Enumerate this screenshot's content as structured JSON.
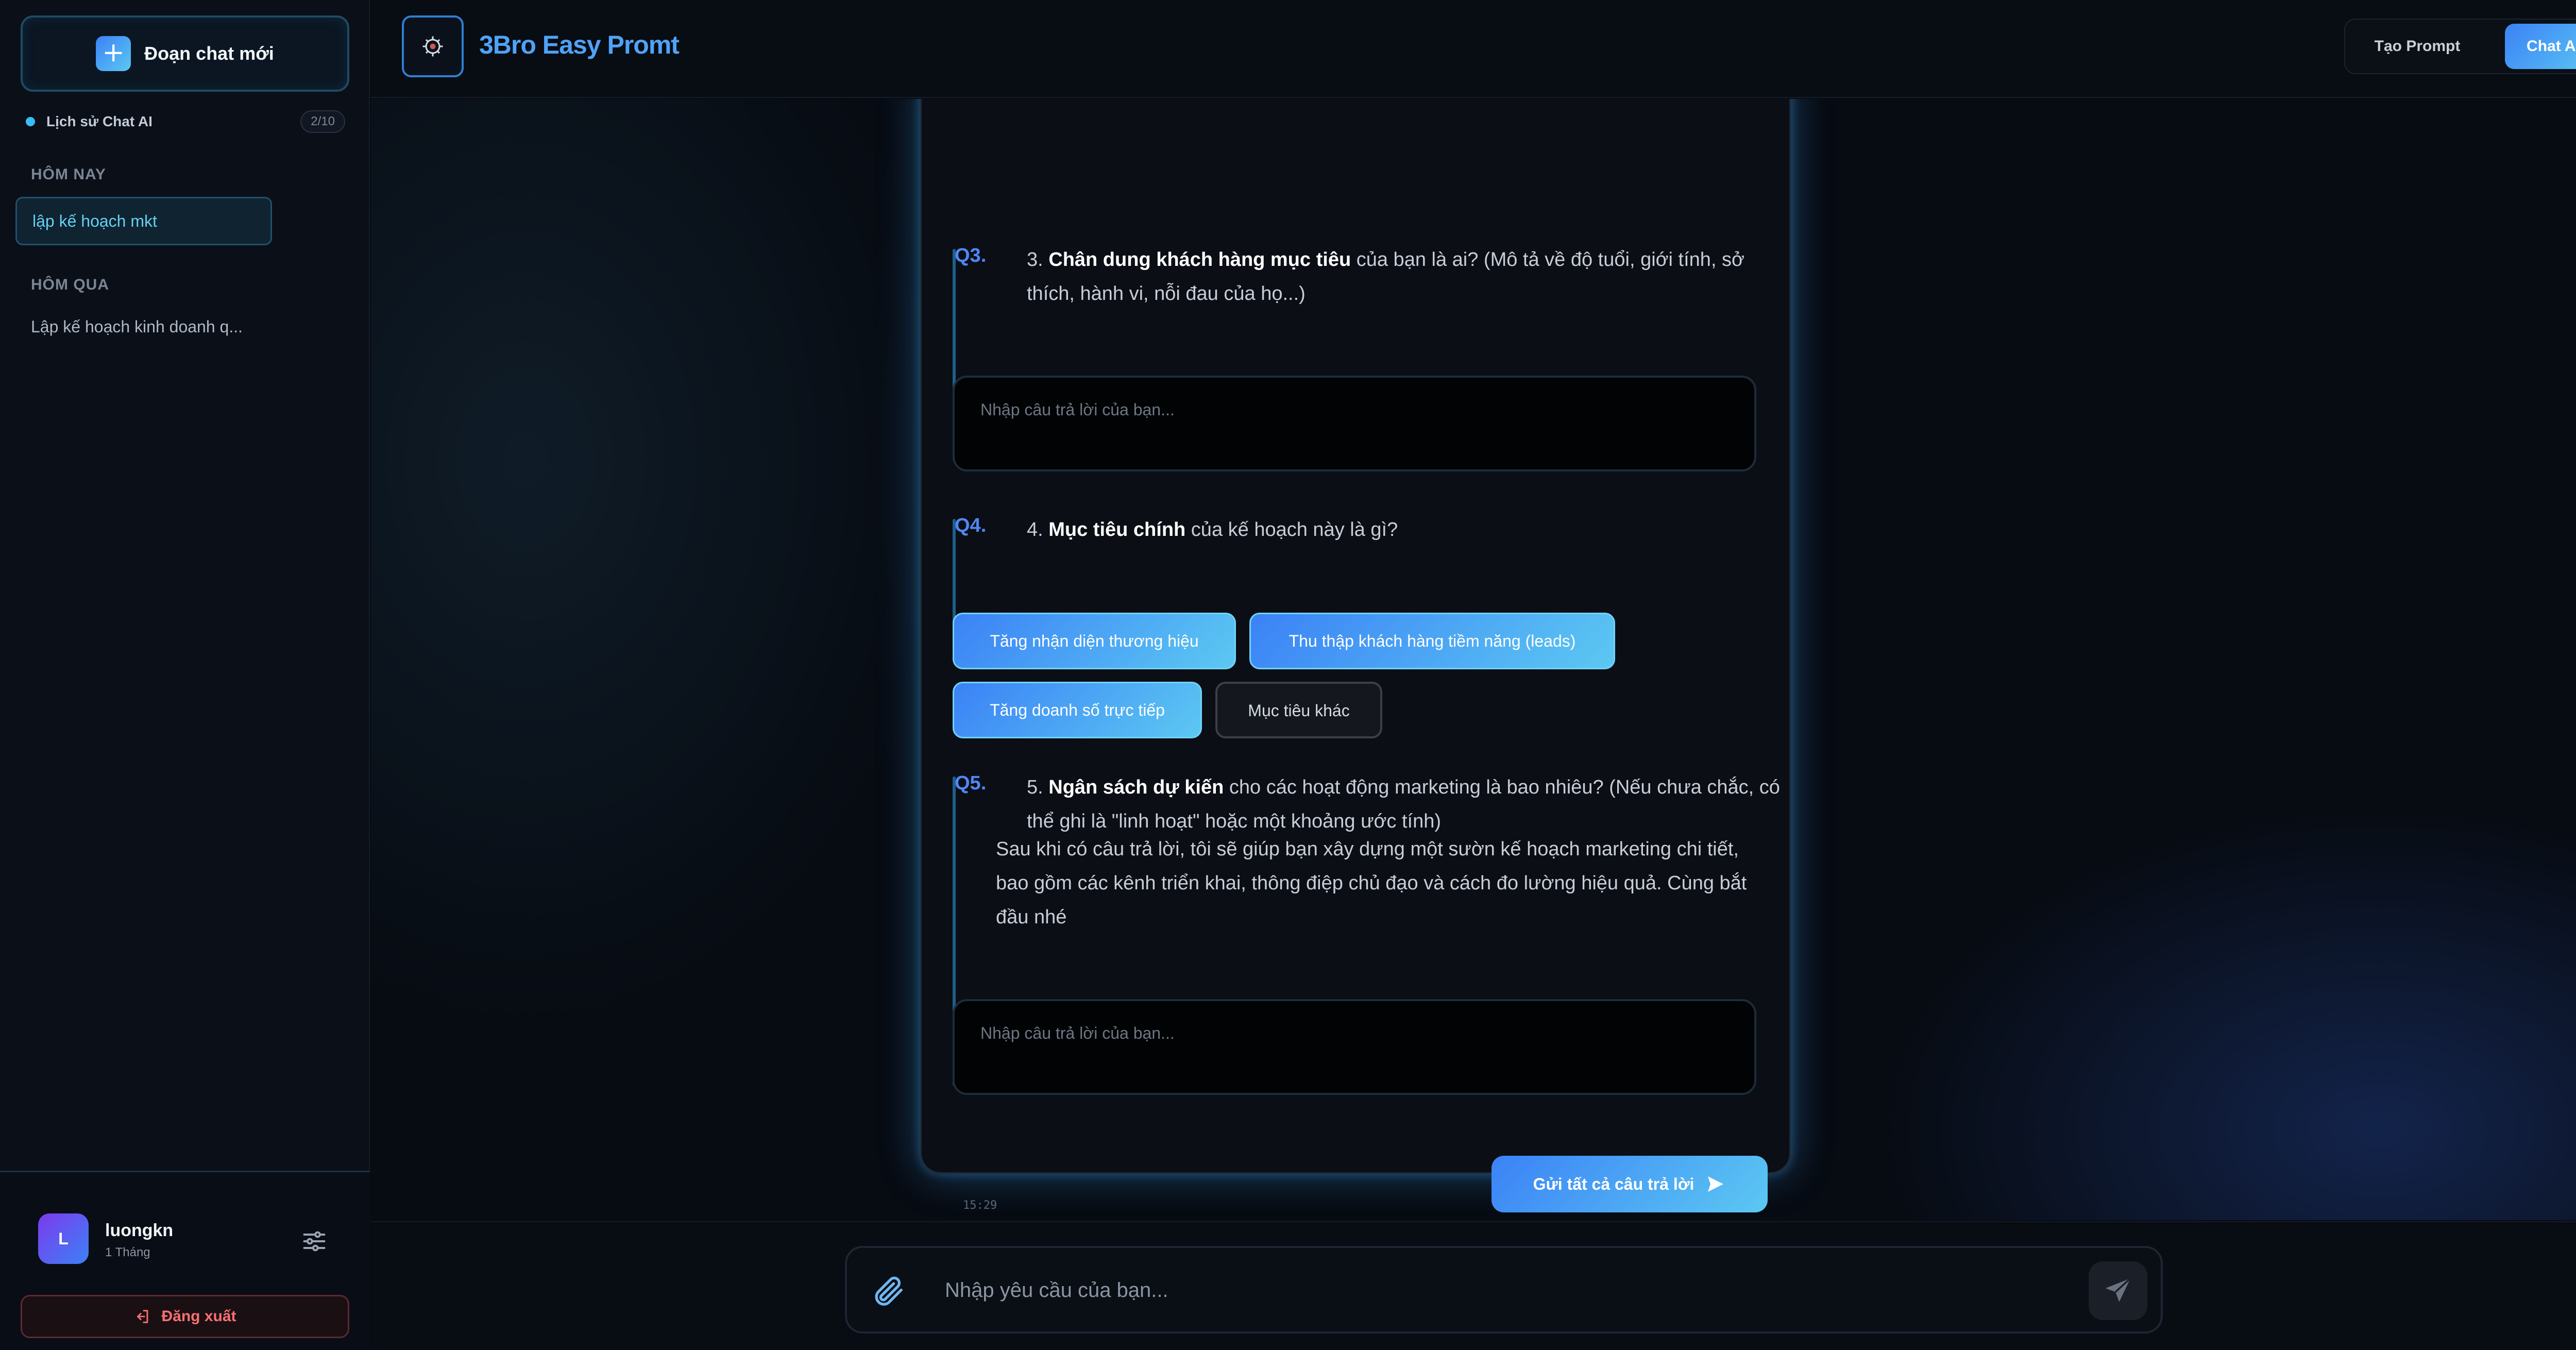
{
  "sidebar": {
    "new_chat_label": "Đoạn chat mới",
    "history_label": "Lịch sử Chat AI",
    "history_count": "2/10",
    "sections": [
      {
        "title": "HÔM NAY",
        "items": [
          "lập kế hoạch mkt"
        ]
      },
      {
        "title": "HÔM QUA",
        "items": [
          "Lập kế hoạch kinh doanh q..."
        ]
      }
    ],
    "user": {
      "initial": "L",
      "name": "luongkn",
      "plan": "1 Tháng"
    },
    "logout_label": "Đăng xuất"
  },
  "header": {
    "brand": "3Bro Easy Promt",
    "nav": {
      "create_prompt": "Tạo Prompt",
      "chat_ai": "Chat AI"
    },
    "active_nav": "Chat AI"
  },
  "conversation": {
    "q3": {
      "num": "Q3.",
      "prefix": "3. ",
      "bold": "Chân dung khách hàng mục tiêu",
      "rest": " của bạn là ai? (Mô tả về độ tuổi, giới tính, sở thích, hành vi, nỗi đau của họ...)",
      "answer_placeholder": "Nhập câu trả lời của bạn..."
    },
    "q4": {
      "num": "Q4.",
      "prefix": "4. ",
      "bold": "Mục tiêu chính",
      "rest": " của kế hoạch này là gì?",
      "options": [
        {
          "label": "Tăng nhận diện thương hiệu",
          "selected": true
        },
        {
          "label": "Thu thập khách hàng tiềm năng (leads)",
          "selected": true
        },
        {
          "label": "Tăng doanh số trực tiếp",
          "selected": true
        },
        {
          "label": "Mục tiêu khác",
          "selected": false
        }
      ]
    },
    "q5": {
      "num": "Q5.",
      "prefix": "5. ",
      "bold": "Ngân sách dự kiến",
      "rest": " cho các hoạt động marketing là bao nhiêu? (Nếu chưa chắc, có thể ghi là \"linh hoạt\" hoặc một khoảng ước tính)",
      "followup": "Sau khi có câu trả lời, tôi sẽ giúp bạn xây dựng một sườn kế hoạch marketing chi tiết, bao gồm các kênh triển khai, thông điệp chủ đạo và cách đo lường hiệu quả. Cùng bắt đầu nhé",
      "answer_placeholder": "Nhập câu trả lời của bạn..."
    },
    "send_all_label": "Gửi tất cả câu trả lời",
    "timestamp": "15:29"
  },
  "composer": {
    "placeholder": "Nhập yêu cầu của bạn..."
  },
  "colors": {
    "accent_start": "#3b82f6",
    "accent_end": "#5cc8f2",
    "brand_text": "#4fa3f7",
    "logout_red": "#f87171"
  },
  "icons": [
    "plus-icon",
    "settings-sliders-icon",
    "logout-icon",
    "logo-icon",
    "send-arrow-icon",
    "paperclip-icon",
    "paper-plane-icon"
  ]
}
